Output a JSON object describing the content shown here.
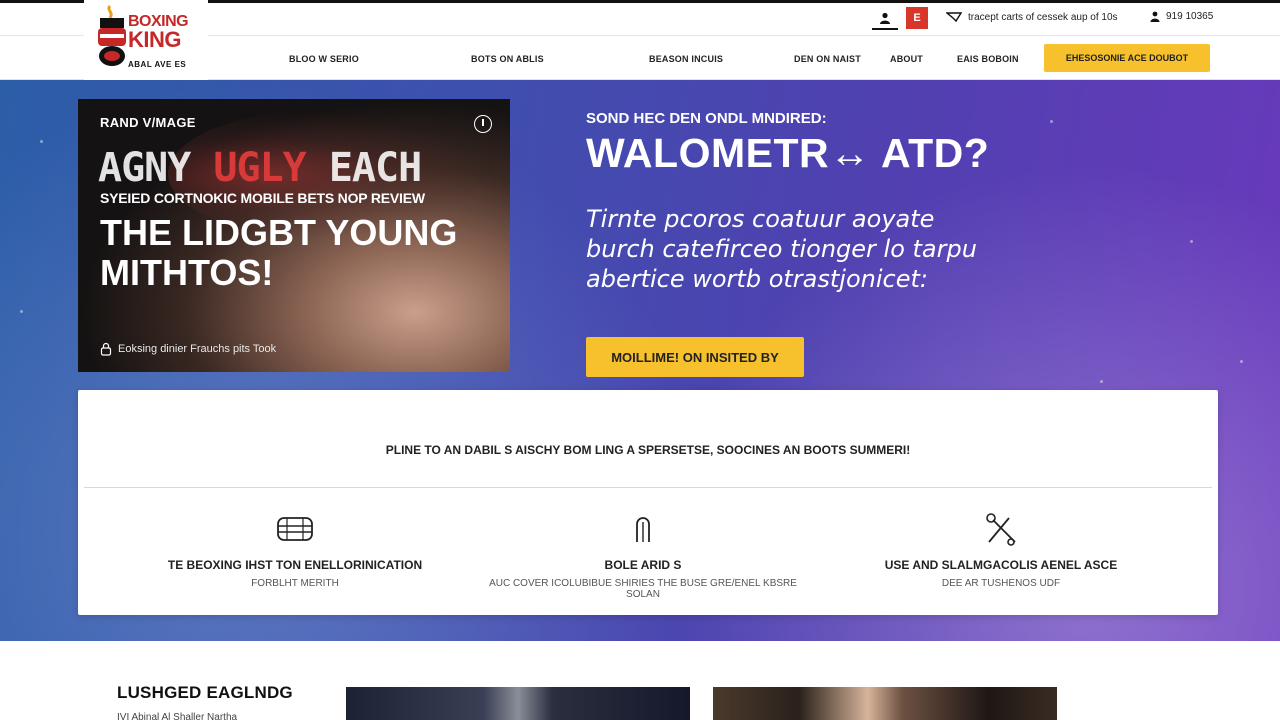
{
  "brand": {
    "name_line1": "BOXING",
    "name_line2": "KING",
    "tagline": "ABAL AVE ES"
  },
  "topbar": {
    "user_icon": "user-icon",
    "flag_label": "E",
    "promo_text": "tracept carts of cessek aup of 10s",
    "phone": "919 10365"
  },
  "nav": {
    "items": [
      {
        "label": "BLOO W SERIO"
      },
      {
        "label": "BOTS ON ABLIS"
      },
      {
        "label": "BEASON INCUIS"
      },
      {
        "label": "DEN ON NAIST"
      },
      {
        "label": "ABOUT"
      },
      {
        "label": "EAIS BOBOIN"
      }
    ],
    "cta_label": "EHESOSONIE ACE DOUBOT"
  },
  "promo_card": {
    "brand": "RAND V/MAGE",
    "big_text_1": "AGNY ",
    "big_text_red": "UGLY",
    "big_text_2": " EACH",
    "strap": "SYEIED CORTNOKIC MOBILE BETS NOP REVIEW",
    "headline": "THE LIDGBT YOUNG MITHTOS!",
    "footer": "Eoksing dinier Frauchs pits Took"
  },
  "hero": {
    "kicker": "SOND HEC DEN ONDL MNDIRED:",
    "title": "WALOMETR↔ ATD?",
    "lead": "Tirnte pcoros coatuur aoyate burch catefirceo tionger lo tarpu abertice wortb otrastjonicet:",
    "cta_label": "MOILLIME! ON INSITED BY"
  },
  "features": {
    "heading": "PLINE TO AN DABIL S AISCHY BOM LING A SPERSETSE, SOOCINES AN BOOTS SUMMERI!",
    "items": [
      {
        "title": "TE BEOXING IHST TON ENELLORINICATION",
        "subtitle": "FORBLHT MERITH",
        "icon": "boxing-ring-icon"
      },
      {
        "title": "BOLE ARID S",
        "subtitle": "AUC COVER ICOLUBIBUE SHIRIES THE BUSE GRE/ENEL KBSRE SOLAN",
        "icon": "arch-icon"
      },
      {
        "title": "USE AND SLALMGACOLIS AENEL ASCE",
        "subtitle": "DEE AR TUSHENOS UDF",
        "icon": "crossed-tools-icon"
      }
    ]
  },
  "section": {
    "title": "LUSHGED EAGLNDG",
    "text": "IVI Abinal Al Shaller Nartha"
  },
  "colors": {
    "accent_yellow": "#f6c12c",
    "brand_red": "#c62828",
    "hero_blue": "#2c5ea8",
    "hero_purple": "#6b39bd"
  }
}
